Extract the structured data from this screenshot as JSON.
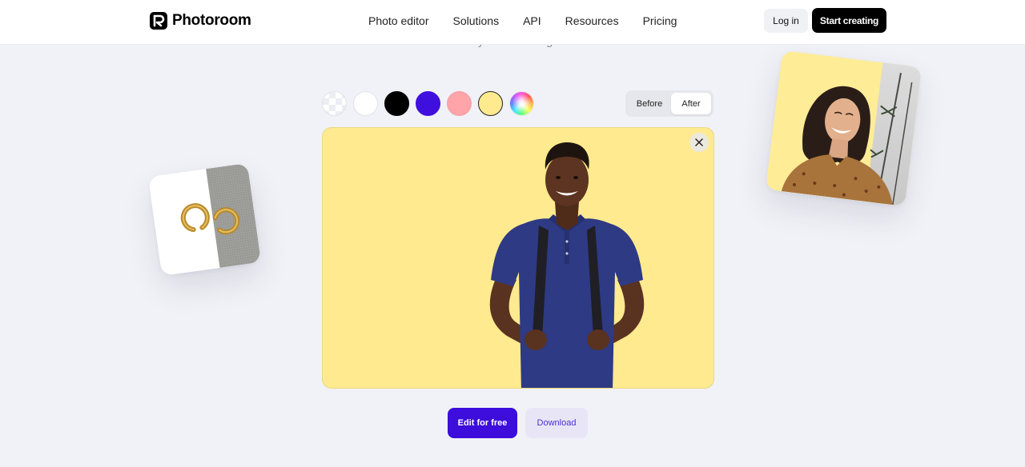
{
  "header": {
    "brand": "Photoroom",
    "nav": [
      {
        "label": "Photo editor"
      },
      {
        "label": "Solutions"
      },
      {
        "label": "API"
      },
      {
        "label": "Resources"
      },
      {
        "label": "Pricing"
      }
    ],
    "login_label": "Log in",
    "cta_label": "Start creating"
  },
  "hero": {
    "tagline_fragment": "your choosing."
  },
  "editor": {
    "swatches": [
      {
        "name": "transparent",
        "color": "transparent",
        "selected": false
      },
      {
        "name": "white",
        "color": "#ffffff",
        "selected": false
      },
      {
        "name": "black",
        "color": "#000000",
        "selected": false
      },
      {
        "name": "purple",
        "color": "#3f0fdd",
        "selected": false
      },
      {
        "name": "pink",
        "color": "#ffa4a9",
        "selected": false
      },
      {
        "name": "yellow",
        "color": "#ffea8f",
        "selected": true
      },
      {
        "name": "custom-color",
        "color": "rainbow",
        "selected": false
      }
    ],
    "toggle": {
      "before_label": "Before",
      "after_label": "After",
      "active": "After"
    },
    "background_color": "#ffea8f",
    "close_icon": "close-icon",
    "image_subject": "Smiling young man in navy polo shirt with backpack"
  },
  "actions": {
    "edit_label": "Edit for free",
    "download_label": "Download"
  },
  "showcase": {
    "left_card": "Gold hoop earrings, background half removed",
    "right_card": "Smiling woman, yellow background half applied"
  },
  "colors": {
    "accent": "#3c0ddb",
    "accent_soft": "#e8e6f6",
    "page_bg": "#f1f2f7",
    "cta_bg": "#000000"
  }
}
